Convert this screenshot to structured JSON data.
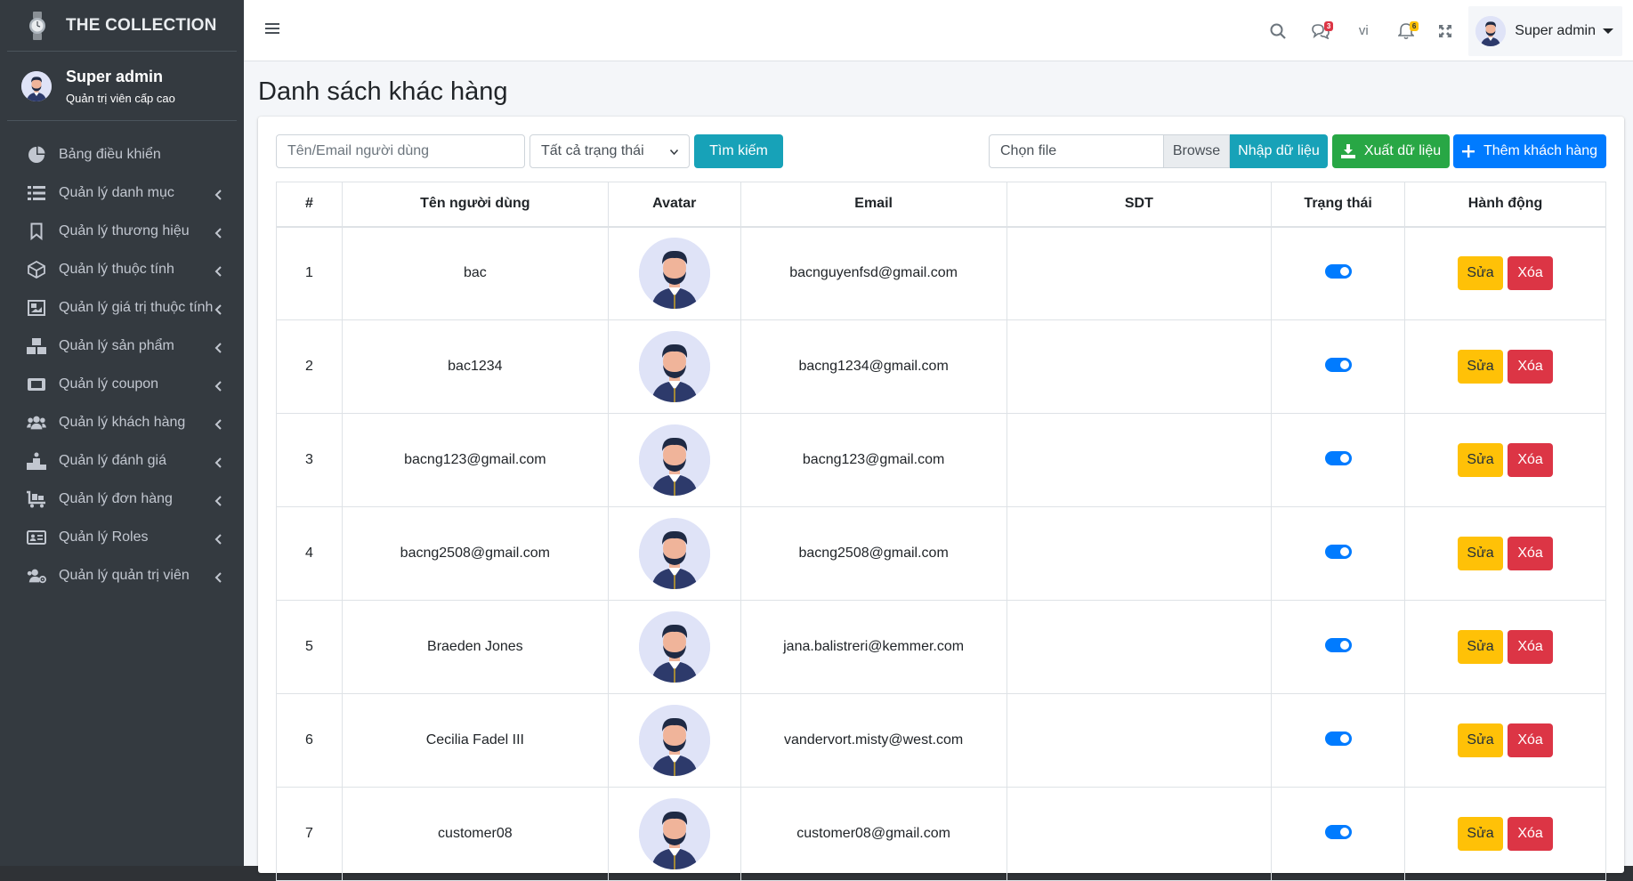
{
  "brand": {
    "name": "THE COLLECTION"
  },
  "user": {
    "name": "Super admin",
    "role": "Quản trị viên cấp cao"
  },
  "sidebar": {
    "items": [
      {
        "label": "Bảng điều khiển",
        "icon": "dashboard-icon",
        "has_children": false
      },
      {
        "label": "Quản lý danh mục",
        "icon": "list-icon",
        "has_children": true
      },
      {
        "label": "Quản lý thương hiệu",
        "icon": "bookmark-icon",
        "has_children": true
      },
      {
        "label": "Quản lý thuộc tính",
        "icon": "cube-icon",
        "has_children": true
      },
      {
        "label": "Quản lý giá trị thuộc tính",
        "icon": "image-icon",
        "has_children": true
      },
      {
        "label": "Quản lý sản phẩm",
        "icon": "boxes-icon",
        "has_children": true
      },
      {
        "label": "Quản lý coupon",
        "icon": "ticket-icon",
        "has_children": true
      },
      {
        "label": "Quản lý khách hàng",
        "icon": "users-icon",
        "has_children": true
      },
      {
        "label": "Quản lý đánh giá",
        "icon": "ranking-icon",
        "has_children": true
      },
      {
        "label": "Quản lý đơn hàng",
        "icon": "cart-icon",
        "has_children": true
      },
      {
        "label": "Quản lý Roles",
        "icon": "id-card-icon",
        "has_children": true
      },
      {
        "label": "Quản lý quản trị viên",
        "icon": "users-cog-icon",
        "has_children": true
      }
    ]
  },
  "navbar": {
    "messages_count": "3",
    "language": "vi",
    "notifications_count": "6",
    "user_name": "Super admin"
  },
  "page": {
    "title": "Danh sách khác hàng"
  },
  "toolbar": {
    "search_placeholder": "Tên/Email người dùng",
    "status_select": "Tất cả trạng thái",
    "search_button": "Tìm kiếm",
    "file_placeholder": "Chọn file",
    "browse": "Browse",
    "import_button": "Nhập dữ liệu",
    "export_button": "Xuất dữ liệu",
    "add_button": "Thêm khách hàng"
  },
  "table": {
    "headers": [
      "#",
      "Tên người dùng",
      "Avatar",
      "Email",
      "SDT",
      "Trạng thái",
      "Hành động"
    ],
    "edit_label": "Sửa",
    "delete_label": "Xóa",
    "rows": [
      {
        "no": "1",
        "name": "bac",
        "email": "bacnguyenfsd@gmail.com",
        "phone": "",
        "active": true
      },
      {
        "no": "2",
        "name": "bac1234",
        "email": "bacng1234@gmail.com",
        "phone": "",
        "active": true
      },
      {
        "no": "3",
        "name": "bacng123@gmail.com",
        "email": "bacng123@gmail.com",
        "phone": "",
        "active": true
      },
      {
        "no": "4",
        "name": "bacng2508@gmail.com",
        "email": "bacng2508@gmail.com",
        "phone": "",
        "active": true
      },
      {
        "no": "5",
        "name": "Braeden Jones",
        "email": "jana.balistreri@kemmer.com",
        "phone": "",
        "active": true
      },
      {
        "no": "6",
        "name": "Cecilia Fadel III",
        "email": "vandervort.misty@west.com",
        "phone": "",
        "active": true
      },
      {
        "no": "7",
        "name": "customer08",
        "email": "customer08@gmail.com",
        "phone": "",
        "active": true
      }
    ]
  },
  "colors": {
    "sidebar_bg": "#343a40",
    "primary": "#007bff",
    "info": "#17a2b8",
    "success": "#28a745",
    "warning": "#ffc107",
    "danger": "#dc3545"
  }
}
